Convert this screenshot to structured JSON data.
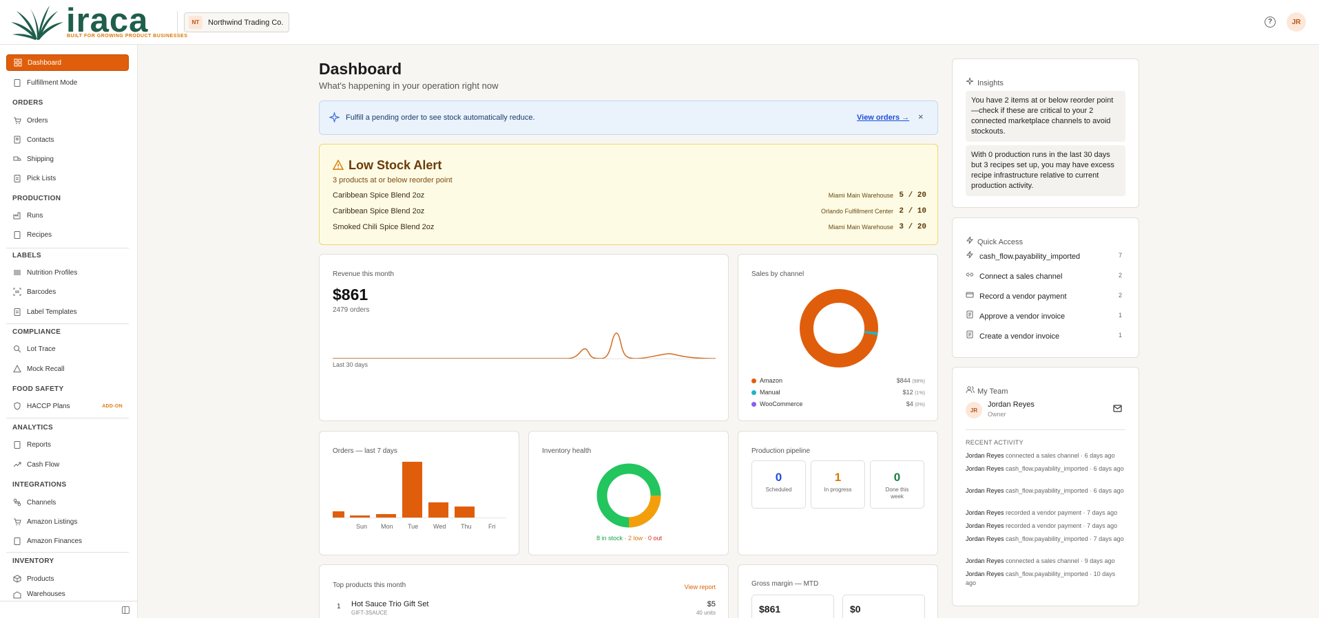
{
  "brand": {
    "word": "iraca",
    "tagline": "BUILT FOR GROWING PRODUCT BUSINESSES",
    "colors": {
      "primary": "#e05e0b",
      "brand_green": "#1f5e4b"
    }
  },
  "org": {
    "badge": "NT",
    "name": "Northwind Trading Co."
  },
  "header": {
    "help_icon": "?",
    "avatar": "JR"
  },
  "sidebar": {
    "dashboard": "Dashboard",
    "fulfillment": "Fulfillment Mode",
    "sec_orders": "ORDERS",
    "orders": "Orders",
    "contacts": "Contacts",
    "shipping": "Shipping",
    "pick_lists": "Pick Lists",
    "sec_production": "PRODUCTION",
    "runs": "Runs",
    "recipes": "Recipes",
    "sec_labels": "LABELS",
    "nutrition": "Nutrition Profiles",
    "barcodes": "Barcodes",
    "label_templates": "Label Templates",
    "sec_compliance": "COMPLIANCE",
    "lot_trace": "Lot Trace",
    "mock_recall": "Mock Recall",
    "sec_food": "FOOD SAFETY",
    "haccp": "HACCP Plans",
    "addon": "ADD-ON",
    "sec_analytics": "ANALYTICS",
    "reports": "Reports",
    "cash_flow": "Cash Flow",
    "sec_integrations": "INTEGRATIONS",
    "channels": "Channels",
    "amazon_listings": "Amazon Listings",
    "amazon_finances": "Amazon Finances",
    "sec_inventory": "INVENTORY",
    "products": "Products",
    "warehouses": "Warehouses"
  },
  "page": {
    "title": "Dashboard",
    "subtitle": "What's happening in your operation right now"
  },
  "info_banner": {
    "text": "Fulfill a pending order to see stock automatically reduce.",
    "link": "View orders →",
    "close": "×"
  },
  "low_stock": {
    "title": "Low Stock Alert",
    "subtitle": "3 products at or below reorder point",
    "rows": [
      {
        "product": "Caribbean Spice Blend 2oz",
        "warehouse": "Miami Main Warehouse",
        "qty": "5 / 20"
      },
      {
        "product": "Caribbean Spice Blend 2oz",
        "warehouse": "Orlando Fulfillment Center",
        "qty": "2 / 10"
      },
      {
        "product": "Smoked Chili Spice Blend 2oz",
        "warehouse": "Miami Main Warehouse",
        "qty": "3 / 20"
      }
    ]
  },
  "revenue": {
    "label": "Revenue this month",
    "value": "$861",
    "orders": "2479 orders",
    "period": "Last 30 days"
  },
  "sales_channel": {
    "title": "Sales by channel",
    "items": [
      {
        "name": "Amazon",
        "value": "$844",
        "pct": "(98%)",
        "color": "#e05e0b"
      },
      {
        "name": "Manual",
        "value": "$12",
        "pct": "(1%)",
        "color": "#1fb5c9"
      },
      {
        "name": "WooCommerce",
        "value": "$4",
        "pct": "(0%)",
        "color": "#8b5cf6"
      }
    ]
  },
  "orders_week": {
    "title": "Orders — last 7 days",
    "days": [
      "Sun",
      "Mon",
      "Tue",
      "Wed",
      "Thu",
      "Fri"
    ]
  },
  "inventory": {
    "title": "Inventory health",
    "in_stock": "8 in stock",
    "low": "2 low",
    "out": "0 out",
    "sep": " · ",
    "colors": {
      "in_stock": "#22c55e",
      "low": "#f59e0b",
      "out": "#dc2626"
    }
  },
  "pipeline": {
    "title": "Production pipeline",
    "items": [
      {
        "count": "0",
        "label": "Scheduled",
        "color": "#1d4ed8"
      },
      {
        "count": "1",
        "label": "In progress",
        "color": "#d97706"
      },
      {
        "count": "0",
        "label": "Done this week",
        "color": "#15803d"
      }
    ]
  },
  "top_products": {
    "title": "Top products this month",
    "link": "View report",
    "rows": [
      {
        "rank": "1",
        "name": "Hot Sauce Trio Gift Set",
        "sku": "GIFT-3SAUCE",
        "value": "$5",
        "units": "40 units"
      }
    ]
  },
  "gross_margin": {
    "title": "Gross margin — MTD",
    "revenue": "$861",
    "cost": "$0"
  },
  "insights": {
    "title": "Insights",
    "items": [
      "You have 2 items at or below reorder point—check if these are critical to your 2 connected marketplace channels to avoid stockouts.",
      "With 0 production runs in the last 30 days but 3 recipes set up, you may have excess recipe infrastructure relative to current production activity."
    ]
  },
  "quick_access": {
    "title": "Quick Access",
    "items": [
      {
        "label": "cash_flow.payability_imported",
        "count": "7",
        "icon": "bolt-icon"
      },
      {
        "label": "Connect a sales channel",
        "count": "2",
        "icon": "link-icon"
      },
      {
        "label": "Record a vendor payment",
        "count": "2",
        "icon": "card-icon"
      },
      {
        "label": "Approve a vendor invoice",
        "count": "1",
        "icon": "invoice-icon"
      },
      {
        "label": "Create a vendor invoice",
        "count": "1",
        "icon": "invoice-icon"
      }
    ]
  },
  "team": {
    "title": "My Team",
    "member": {
      "initials": "JR",
      "name": "Jordan Reyes",
      "role": "Owner"
    },
    "activity_title": "RECENT ACTIVITY",
    "activity": [
      {
        "user": "Jordan Reyes",
        "text": " connected a sales channel · 6 days ago"
      },
      {
        "user": "Jordan Reyes",
        "text": " cash_flow.payability_imported · 6 days ago"
      },
      {
        "user": "Jordan Reyes",
        "text": " cash_flow.payability_imported · 6 days ago"
      },
      {
        "user": "Jordan Reyes",
        "text": " recorded a vendor payment · 7 days ago"
      },
      {
        "user": "Jordan Reyes",
        "text": " recorded a vendor payment · 7 days ago"
      },
      {
        "user": "Jordan Reyes",
        "text": " cash_flow.payability_imported · 7 days ago"
      },
      {
        "user": "Jordan Reyes",
        "text": " connected a sales channel · 9 days ago"
      },
      {
        "user": "Jordan Reyes",
        "text": " cash_flow.payability_imported · 10 days ago"
      }
    ]
  }
}
